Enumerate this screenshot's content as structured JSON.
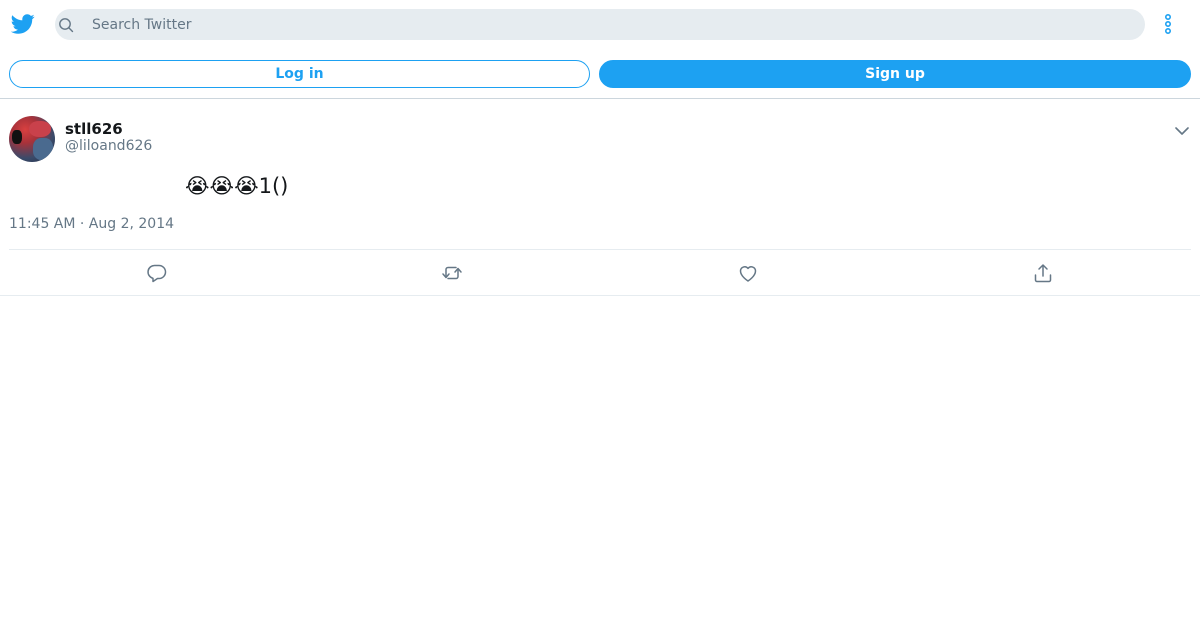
{
  "header": {
    "logo_icon": "twitter-bird-icon",
    "search": {
      "placeholder": "Search Twitter",
      "value": ""
    },
    "more_icon": "more-vertical-icon"
  },
  "auth": {
    "login_label": "Log in",
    "signup_label": "Sign up"
  },
  "tweet": {
    "display_name": "stll626",
    "handle": "@liloand626",
    "text": "😭😭😭1()",
    "timestamp": "11:45 AM · Aug 2, 2014",
    "actions": [
      "reply-icon",
      "retweet-icon",
      "like-icon",
      "share-icon"
    ]
  },
  "colors": {
    "brand": "#1da1f2",
    "secondary_text": "#657786",
    "search_bg": "#e6ecf0",
    "divider": "#ccd6dd"
  }
}
